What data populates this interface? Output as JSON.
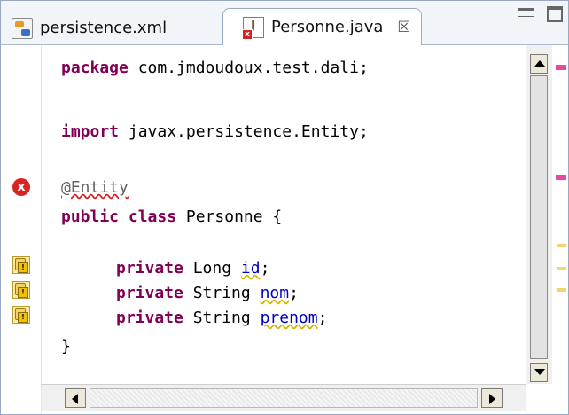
{
  "tabs": [
    {
      "label": "persistence.xml",
      "icon": "xml-file-icon"
    },
    {
      "label": "Personne.java",
      "icon": "java-file-error-icon",
      "close": "☒"
    }
  ],
  "code": {
    "package_kw": "package",
    "package_name": " com.jmdoudoux.test.dali;",
    "import_kw": "import",
    "import_name": " javax.persistence.Entity;",
    "annotation": "@Entity",
    "public_kw": "public",
    "class_kw": "class",
    "class_name": " Personne {",
    "field1": {
      "kw": "private",
      "type": " Long ",
      "name": "id",
      "end": ";"
    },
    "field2": {
      "kw": "private",
      "type": " String ",
      "name": "nom",
      "end": ";"
    },
    "field3": {
      "kw": "private",
      "type": " String ",
      "name": "prenom",
      "end": ";"
    },
    "close_brace": "}"
  },
  "markers": {
    "annotation_line": "error",
    "field_lines": [
      "warning",
      "warning",
      "warning"
    ]
  },
  "colors": {
    "keyword": "#7f0055",
    "annotation": "#646464",
    "field": "#0000c0",
    "current_line": "#e8f2fe",
    "error": "#d52525",
    "warning": "#f2d56c"
  }
}
